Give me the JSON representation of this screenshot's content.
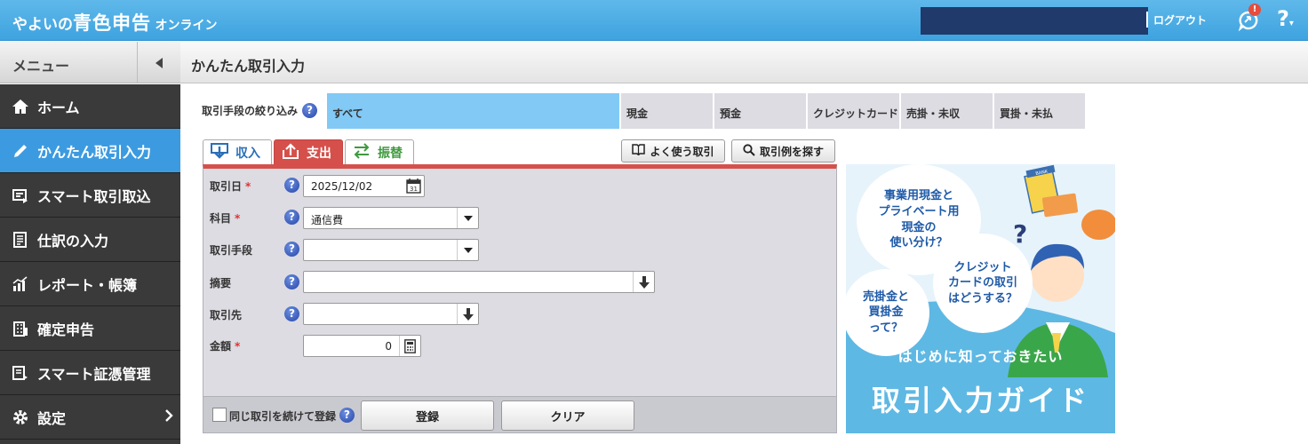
{
  "header": {
    "logo_part1": "やよいの",
    "logo_part2": "青色申告",
    "logo_part3": "オンライン",
    "logout_label": "ログアウト",
    "notification_badge": "!",
    "help_label": "?"
  },
  "sidebar": {
    "menu_label": "メニュー",
    "items": [
      {
        "label": "ホーム",
        "icon": "home-icon"
      },
      {
        "label": "かんたん取引入力",
        "icon": "pencil-icon"
      },
      {
        "label": "スマート取引取込",
        "icon": "import-icon"
      },
      {
        "label": "仕訳の入力",
        "icon": "journal-icon"
      },
      {
        "label": "レポート・帳簿",
        "icon": "chart-icon"
      },
      {
        "label": "確定申告",
        "icon": "building-icon"
      },
      {
        "label": "スマート証憑管理",
        "icon": "document-icon"
      },
      {
        "label": "設定",
        "icon": "gear-icon"
      }
    ]
  },
  "page": {
    "title": "かんたん取引入力"
  },
  "filter": {
    "label": "取引手段の絞り込み",
    "options": [
      "すべて",
      "現金",
      "預金",
      "クレジットカード",
      "売掛・未収",
      "買掛・未払"
    ],
    "selected": "すべて"
  },
  "tabs": {
    "income": "収入",
    "expense": "支出",
    "transfer": "振替",
    "active": "支出"
  },
  "tools": {
    "frequent": "よく使う取引",
    "search_examples": "取引例を探す"
  },
  "form": {
    "date_label": "取引日",
    "date_value": "2025/12/02",
    "account_label": "科目",
    "account_value": "通信費",
    "method_label": "取引手段",
    "method_value": "",
    "memo_label": "摘要",
    "memo_value": "",
    "partner_label": "取引先",
    "partner_value": "",
    "amount_label": "金額",
    "amount_value": "0",
    "required_mark": "*"
  },
  "footer": {
    "continue_label": "同じ取引を続けて登録",
    "register_button": "登録",
    "clear_button": "クリア"
  },
  "banner": {
    "bubble1": "事業用現金と\nプライベート用\n現金の\n使い分け？",
    "bubble2": "クレジット\nカードの取引\nはどうする？",
    "bubble3": "売掛金と\n買掛金\nって？",
    "bank_sign": "BANK",
    "subtitle": "はじめに知っておきたい",
    "title": "取引入力ガイド"
  },
  "colors": {
    "header_blue": "#3ea3df",
    "sidebar_dark": "#3a3a3a",
    "active_blue": "#3c9be0",
    "expense_red": "#d5504b",
    "filter_selected": "#82c9f5"
  }
}
